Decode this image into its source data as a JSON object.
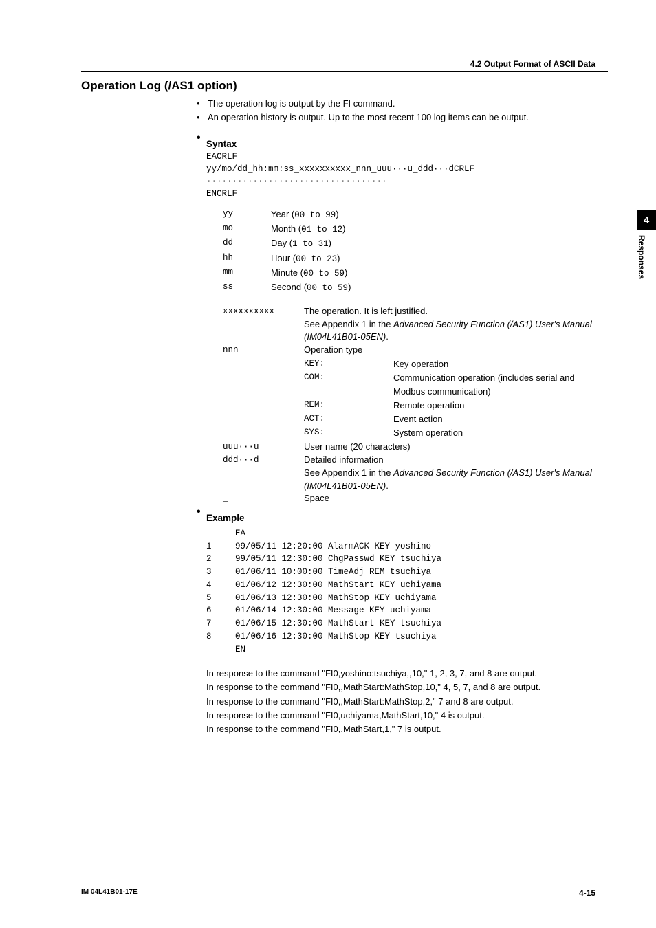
{
  "header": {
    "section_title": "4.2  Output Format of ASCII Data"
  },
  "title": "Operation Log (/AS1 option)",
  "intro_bullets": [
    "The operation log is output by the FI command.",
    "An operation history is output. Up to the most recent 100 log items can be output."
  ],
  "syntax": {
    "heading": "Syntax",
    "lines": [
      "EACRLF",
      "yy/mo/dd_hh:mm:ss_xxxxxxxxxx_nnn_uuu···u_ddd···dCRLF",
      "···································",
      "ENCRLF"
    ],
    "fields1": [
      {
        "key": "yy",
        "label": "Year (",
        "range": "00 to 99",
        "after": ")"
      },
      {
        "key": "mo",
        "label": "Month (",
        "range": "01 to 12",
        "after": ")"
      },
      {
        "key": "dd",
        "label": "Day (",
        "range": "1 to 31",
        "after": ")"
      },
      {
        "key": "hh",
        "label": "Hour (",
        "range": "00 to 23",
        "after": ")"
      },
      {
        "key": "mm",
        "label": "Minute (",
        "range": "00 to 59",
        "after": ")"
      },
      {
        "key": "ss",
        "label": "Second (",
        "range": "00 to 59",
        "after": ")"
      }
    ],
    "fields2": {
      "xxxxxxxxxx": {
        "key": "xxxxxxxxxx",
        "line1": "The operation. It is left justified.",
        "line2a": "See Appendix 1 in the ",
        "line2b": "Advanced Security Function (/AS1) User's Manual (IM04L41B01-05EN)",
        "line2c": "."
      },
      "nnn": {
        "key": "nnn",
        "label": "Operation type",
        "ops": [
          {
            "code": "KEY",
            "desc": "Key operation"
          },
          {
            "code": "COM",
            "desc": "Communication operation (includes serial and Modbus communication)"
          },
          {
            "code": "REM",
            "desc": "Remote operation"
          },
          {
            "code": "ACT",
            "desc": "Event action"
          },
          {
            "code": "SYS",
            "desc": "System operation"
          }
        ]
      },
      "uuu": {
        "key": "uuu···u",
        "label": "User name (20 characters)"
      },
      "ddd": {
        "key": "ddd···d",
        "label": "Detailed information",
        "line2a": "See Appendix 1 in the ",
        "line2b": "Advanced Security Function (/AS1) User's Manual (IM04L41B01-05EN)",
        "line2c": "."
      },
      "space": {
        "key": "_",
        "label": "Space"
      }
    }
  },
  "example": {
    "heading": "Example",
    "pre": "EA",
    "rows": [
      {
        "n": "1",
        "line": "99/05/11 12:20:00 AlarmACK   KEY yoshino"
      },
      {
        "n": "2",
        "line": "99/05/11 12:30:00 ChgPasswd  KEY tsuchiya"
      },
      {
        "n": "3",
        "line": "01/06/11 10:00:00 TimeAdj    REM tsuchiya"
      },
      {
        "n": "4",
        "line": "01/06/12 12:30:00 MathStart  KEY uchiyama"
      },
      {
        "n": "5",
        "line": "01/06/13 12:30:00 MathStop   KEY uchiyama"
      },
      {
        "n": "6",
        "line": "01/06/14 12:30:00 Message    KEY uchiyama"
      },
      {
        "n": "7",
        "line": "01/06/15 12:30:00 MathStart  KEY tsuchiya"
      },
      {
        "n": "8",
        "line": "01/06/16 12:30:00 MathStop   KEY tsuchiya"
      }
    ],
    "post": "EN",
    "notes": [
      "In response to the command \"FI0,yoshino:tsuchiya,,10,\" 1, 2, 3, 7, and 8 are output.",
      "In response to the command \"FI0,,MathStart:MathStop,10,\" 4, 5, 7, and 8 are output.",
      "In response to the command \"FI0,,MathStart:MathStop,2,\" 7 and 8 are output.",
      "In response to the command \"FI0,uchiyama,MathStart,10,\" 4 is output.",
      "In response to the command \"FI0,,MathStart,1,\" 7 is output."
    ]
  },
  "sidetab": {
    "num": "4",
    "label": "Responses"
  },
  "footer": {
    "left": "IM 04L41B01-17E",
    "right": "4-15"
  }
}
